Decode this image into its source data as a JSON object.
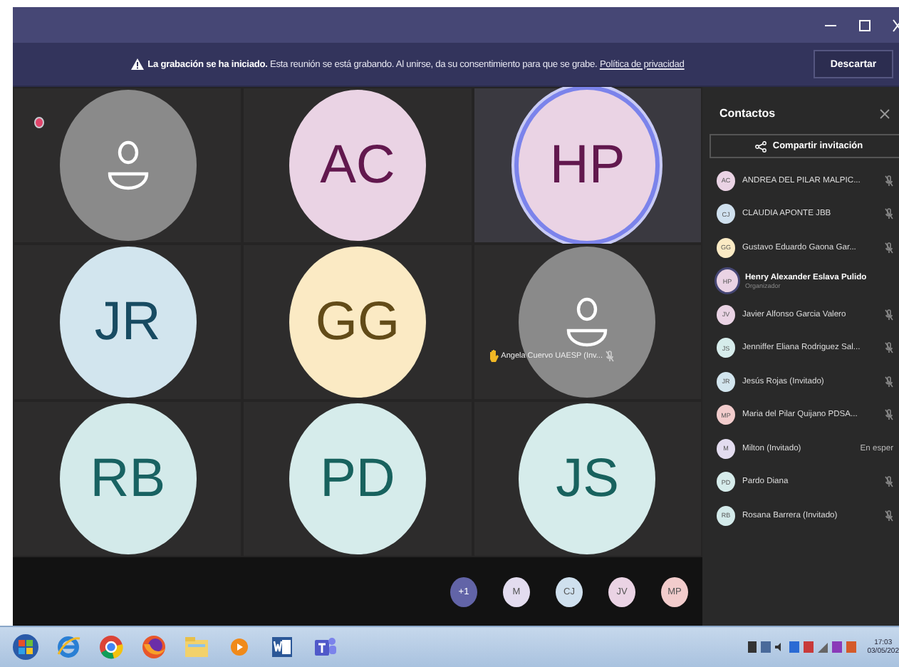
{
  "banner": {
    "text": "**La grabación se ha iniciado.** Esta reunión se está grabando. Al unirse, da su consentimiento para que se grabe.",
    "link": "Política de privacidad",
    "button": "Descartar"
  },
  "tiles": [
    {
      "kind": "generic",
      "recording": true,
      "speaking": false
    },
    {
      "kind": "initials",
      "initials": "AC",
      "color": "#ead3e4",
      "speaking": false
    },
    {
      "kind": "initials",
      "initials": "HP",
      "color": "#ead3e4",
      "speaking": true
    },
    {
      "kind": "initials",
      "initials": "JR",
      "color": "#d2e5ee",
      "speaking": false
    },
    {
      "kind": "initials",
      "initials": "GG",
      "color": "#fbeac4",
      "speaking": false
    },
    {
      "kind": "generic",
      "recording": false,
      "speaking": false,
      "label": "Angela Cuervo UAESP (Inv...",
      "hand_raised": true,
      "muted": true
    },
    {
      "kind": "initials",
      "initials": "RB",
      "color": "#d3eaea",
      "speaking": false
    },
    {
      "kind": "initials",
      "initials": "PD",
      "color": "#d6eceb",
      "speaking": false
    },
    {
      "kind": "initials",
      "initials": "JS",
      "color": "#d6eceb",
      "speaking": false
    }
  ],
  "lobby": [
    {
      "initials": "+1",
      "color": "#6264a7"
    },
    {
      "initials": "M",
      "color": "#e3dcef"
    },
    {
      "initials": "CJ",
      "color": "#cfe0ee"
    },
    {
      "initials": "JV",
      "color": "#ead3e4"
    },
    {
      "initials": "MP",
      "color": "#f2cccc"
    }
  ],
  "panel": {
    "title": "Contactos",
    "share": "Compartir invitación",
    "people": [
      {
        "initials": "AC",
        "name": "ANDREA DEL PILAR MALPIC...",
        "color": "#ead3e4",
        "muted": true
      },
      {
        "initials": "CJ",
        "name": "CLAUDIA APONTE JBB",
        "color": "#cfe0ee",
        "muted": true
      },
      {
        "initials": "GG",
        "name": "Gustavo Eduardo Gaona Gar...",
        "color": "#fbeac4",
        "muted": true
      },
      {
        "initials": "HP",
        "name": "Henry Alexander Eslava Pulido",
        "color": "#ead3e4",
        "muted": false,
        "role": "Organizador"
      },
      {
        "initials": "JV",
        "name": "Javier Alfonso Garcia Valero",
        "color": "#ead3e4",
        "muted": true
      },
      {
        "initials": "JS",
        "name": "Jenniffer Eliana Rodriguez Sal...",
        "color": "#d6eceb",
        "muted": true
      },
      {
        "initials": "JR",
        "name": "Jesús Rojas (Invitado)",
        "color": "#d2e5ee",
        "muted": true
      },
      {
        "initials": "MP",
        "name": "Maria del Pilar Quijano PDSA...",
        "color": "#f2cccc",
        "muted": true
      },
      {
        "initials": "M",
        "name": "Milton (Invitado)",
        "color": "#e3dcef",
        "muted": false,
        "status": "En esper"
      },
      {
        "initials": "PD",
        "name": "Pardo Diana",
        "color": "#d6eceb",
        "muted": true
      },
      {
        "initials": "RB",
        "name": "Rosana Barrera (Invitado)",
        "color": "#d3eaea",
        "muted": true
      }
    ]
  },
  "taskbar": {
    "time": "17:03",
    "date": "03/05/202"
  }
}
